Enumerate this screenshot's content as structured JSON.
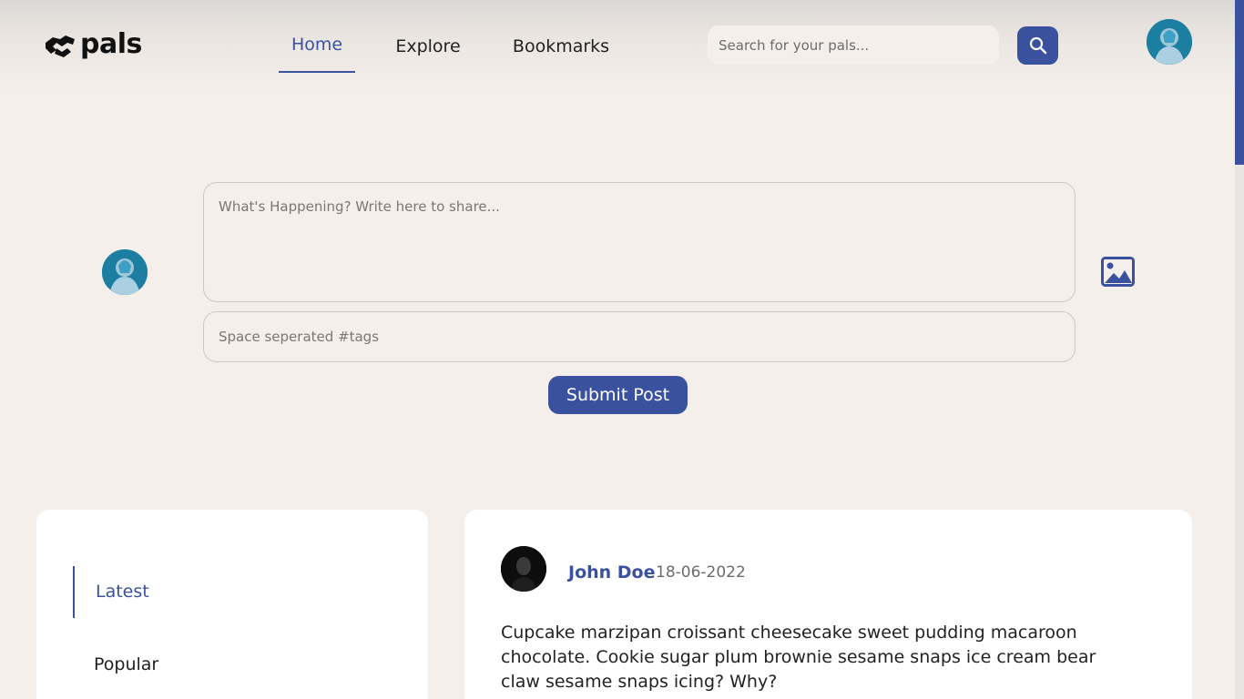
{
  "header": {
    "logo_text": "pals",
    "nav": [
      {
        "label": "Home",
        "active": true
      },
      {
        "label": "Explore",
        "active": false
      },
      {
        "label": "Bookmarks",
        "active": false
      }
    ],
    "search_placeholder": "Search for your pals..."
  },
  "compose": {
    "post_placeholder": "What's Happening? Write here to share...",
    "tags_placeholder": "Space seperated #tags",
    "submit_label": "Submit Post"
  },
  "sidebar": {
    "items": [
      {
        "label": "Latest",
        "active": true
      },
      {
        "label": "Popular",
        "active": false
      }
    ]
  },
  "post": {
    "author": "John Doe",
    "date": "18-06-2022",
    "body": "Cupcake marzipan croissant cheesecake sweet pudding macaroon chocolate. Cookie sugar plum brownie sesame snaps ice cream bear claw sesame snaps icing? Why?"
  },
  "colors": {
    "accent": "#3a51a0",
    "background": "#f4efeb",
    "card": "#ffffff"
  }
}
